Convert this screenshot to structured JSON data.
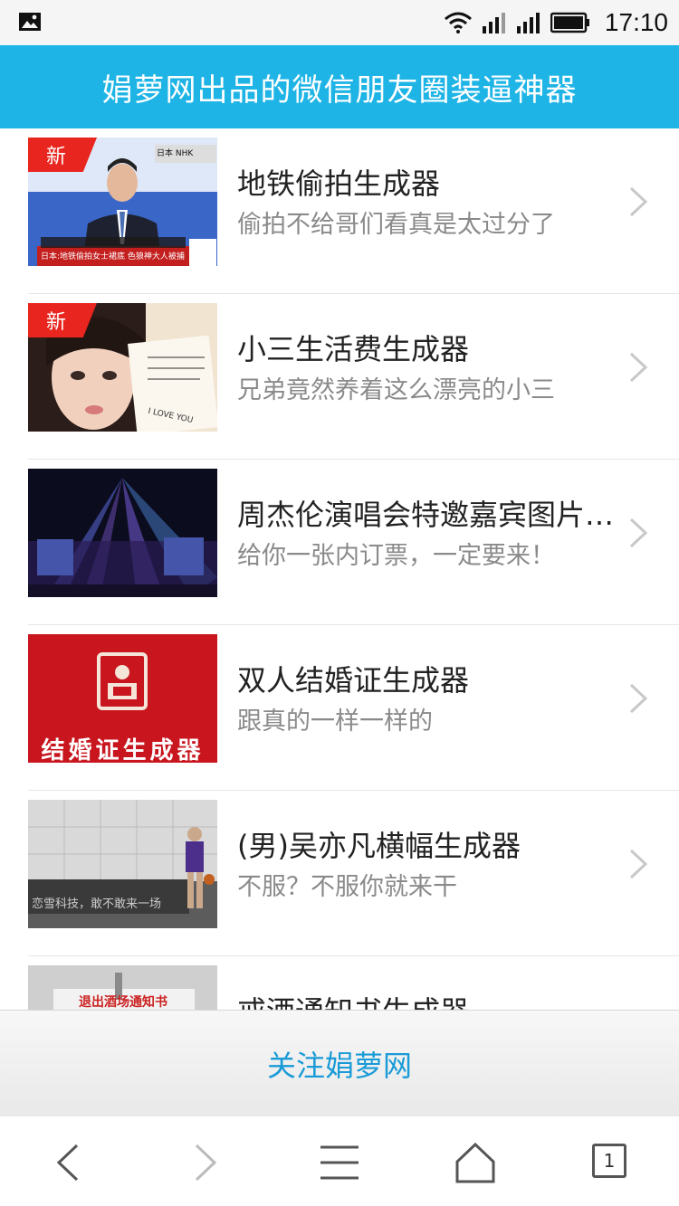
{
  "status_bar": {
    "time": "17:10",
    "icons": [
      "image-icon",
      "wifi-icon",
      "signal-icon",
      "signal-icon",
      "battery-icon"
    ]
  },
  "header": {
    "title": "娟萝网出品的微信朋友圈装逼神器"
  },
  "list": [
    {
      "title": "地铁偷拍生成器",
      "subtitle": "偷拍不给哥们看真是太过分了",
      "badge": "新",
      "thumb": {
        "label_top": "日本 NHK",
        "label_bottom": "日本:地铁偷拍女士裙底 色狼神大人被捕"
      }
    },
    {
      "title": "小三生活费生成器",
      "subtitle": "兄弟竟然养着这么漂亮的小三",
      "badge": "新",
      "thumb": {
        "card_text": "I LOVE YOU"
      }
    },
    {
      "title": "周杰伦演唱会特邀嘉宾图片生成器",
      "subtitle": "给你一张内订票，一定要来！",
      "badge": ""
    },
    {
      "title": "双人结婚证生成器",
      "subtitle": "跟真的一样一样的",
      "badge": "",
      "thumb": {
        "label": "结婚证生成器"
      }
    },
    {
      "title": "(男)吴亦凡横幅生成器",
      "subtitle": "不服？不服你就来干",
      "badge": "",
      "thumb": {
        "banner": "恋雪科技，敢不敢来一场"
      }
    },
    {
      "title": "戒酒通知书生成器",
      "subtitle": "",
      "badge": "",
      "thumb": {
        "label": "退出酒场通知书"
      }
    }
  ],
  "follow": {
    "label": "关注娟萝网"
  },
  "nav": {
    "tabs_count": "1"
  },
  "colors": {
    "header_bg": "#1eb4e6",
    "badge": "#e8261f",
    "link": "#1a9bd7"
  }
}
